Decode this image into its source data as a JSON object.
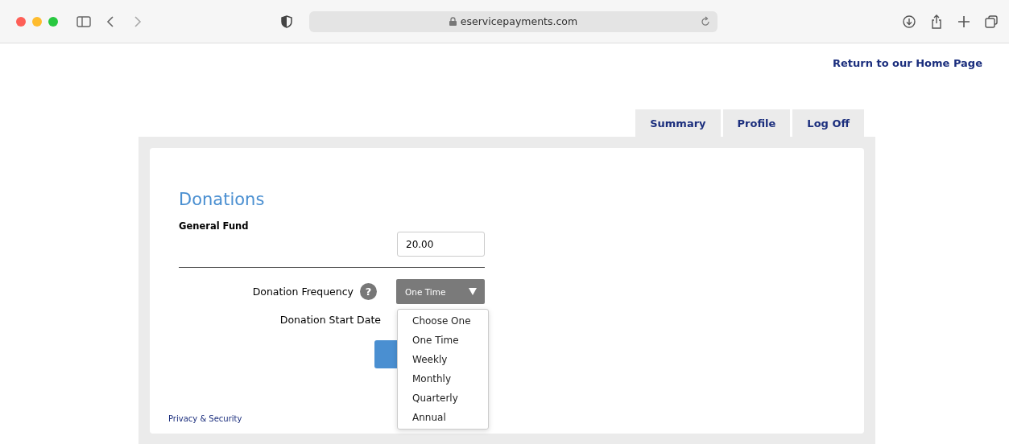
{
  "browser": {
    "url": "eservicepayments.com"
  },
  "header": {
    "home_link": "Return to our Home Page"
  },
  "tabs": [
    {
      "label": "Summary"
    },
    {
      "label": "Profile"
    },
    {
      "label": "Log Off"
    }
  ],
  "page": {
    "title": "Donations",
    "fund_label": "General Fund",
    "amount": "20.00",
    "frequency_label": "Donation Frequency",
    "help": "?",
    "frequency_value": "One Time",
    "start_date_label": "Donation Start Date",
    "footer_link": "Privacy & Security"
  },
  "dropdown": {
    "options": [
      {
        "label": "Choose One"
      },
      {
        "label": "One Time"
      },
      {
        "label": "Weekly"
      },
      {
        "label": "Monthly"
      },
      {
        "label": "Quarterly"
      },
      {
        "label": "Annual"
      }
    ]
  }
}
